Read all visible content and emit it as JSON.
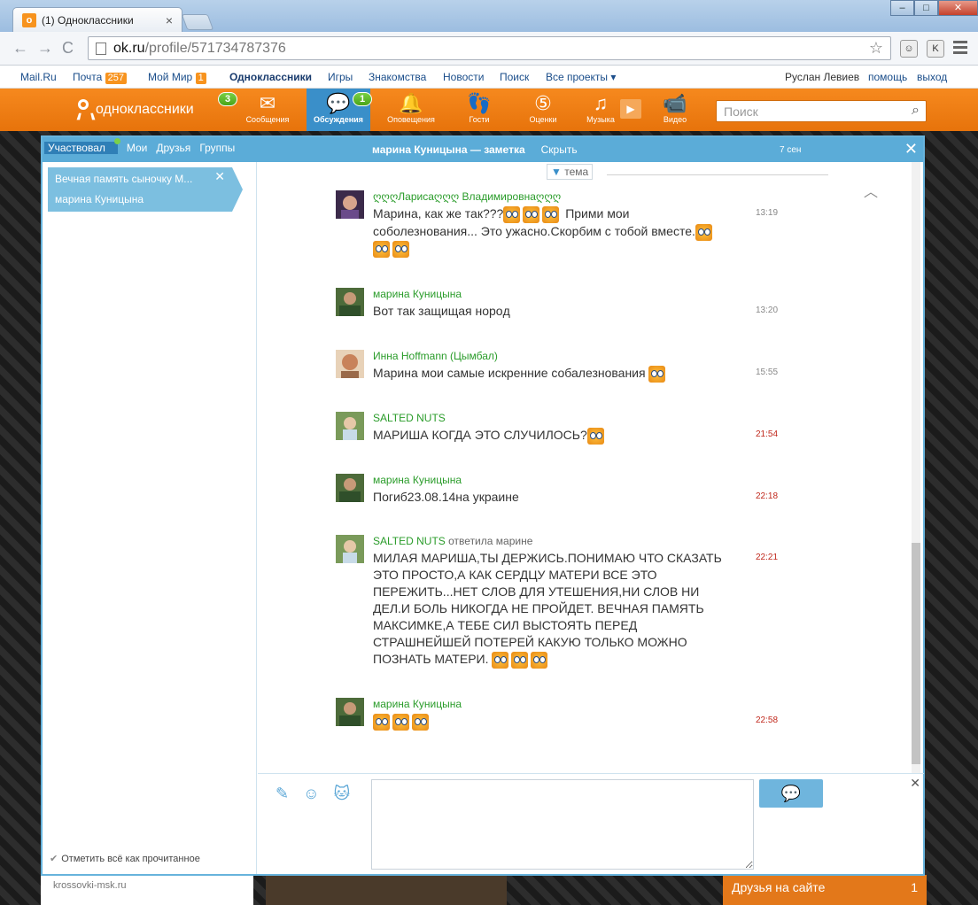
{
  "browser": {
    "tab_title": "(1) Одноклассники",
    "tab_close": "×",
    "url_host": "ok.ru",
    "url_path": "/profile/571734787376",
    "ext1": "☺",
    "ext2": "K"
  },
  "mailbar": {
    "mailru": "Mail.Ru",
    "pochta": "Почта",
    "pochta_count": "257",
    "moimir": "Мой Мир",
    "moimir_count": "1",
    "odnoklassniki": "Одноклассники",
    "igry": "Игры",
    "znakomstva": "Знакомства",
    "novosti": "Новости",
    "poisk": "Поиск",
    "vse_proekty": "Все проекты ▾",
    "user": "Руслан Левиев",
    "help": "помощь",
    "exit": "выход"
  },
  "okbar": {
    "logo": "одноклассники",
    "nav": [
      {
        "label": "Сообщения",
        "badge": "3"
      },
      {
        "label": "Обсуждения",
        "badge": "1"
      },
      {
        "label": "Оповещения",
        "badge": ""
      },
      {
        "label": "Гости",
        "badge": ""
      },
      {
        "label": "Оценки",
        "badge": ""
      },
      {
        "label": "Музыка",
        "badge": ""
      },
      {
        "label": "Видео",
        "badge": ""
      }
    ],
    "search_placeholder": "Поиск"
  },
  "panel": {
    "tabs": [
      "Участвовал",
      "Мои",
      "Друзья",
      "Группы"
    ],
    "title": "марина Куницына — заметка",
    "hide": "Скрыть",
    "date": "7 сен",
    "chat_item_title": "Вечная память сыночку М...",
    "chat_item_author": "марина Куницына",
    "mark_all": "Отметить всё как прочитанное",
    "tema": "тема"
  },
  "messages": [
    {
      "author": "ღღღЛарисаღღღ Владимировнаღღღ",
      "replied": "",
      "text": "Марина, как же так???",
      "text2": " Прими мои соболезнования... Это ужасно.Скорбим с тобой вместе.",
      "time": "13:19",
      "time_red": false
    },
    {
      "author": "марина Куницына",
      "replied": "",
      "text": "Вот так защищая норoд",
      "text2": "",
      "time": "13:20",
      "time_red": false
    },
    {
      "author": "Инна Hoffmann (Цымбал)",
      "replied": "",
      "text": "Марина мои самые искренние собалезнования",
      "text2": "",
      "time": "15:55",
      "time_red": false
    },
    {
      "author": "SALTED NUTS",
      "replied": "",
      "text": "МАРИША КОГДА ЭТО СЛУЧИЛОСЬ?",
      "text2": "",
      "time": "21:54",
      "time_red": true
    },
    {
      "author": "марина Куницына",
      "replied": "",
      "text": "Погиб23.08.14на украине",
      "text2": "",
      "time": "22:18",
      "time_red": true
    },
    {
      "author": "SALTED NUTS",
      "replied": "ответила марине",
      "text": "МИЛАЯ МАРИША,ТЫ ДЕРЖИСЬ.ПОНИМАЮ ЧТО СКАЗАТЬ ЭТО ПРОСТО,А КАК СЕРДЦУ МАТЕРИ ВСЕ ЭТО ПЕРЕЖИТЬ...НЕТ СЛОВ ДЛЯ УТЕШЕНИЯ,НИ СЛОВ НИ ДЕЛ.И БОЛЬ НИКОГДА НЕ ПРОЙДЕТ.  ВЕЧНАЯ ПАМЯТЬ МАКСИМКЕ,А ТЕБЕ СИЛ ВЫСТОЯТЬ ПЕРЕД СТРАШНЕЙШЕЙ ПОТЕРЕЙ КАКУЮ ТОЛЬКО МОЖНО ПОЗНАТЬ МАТЕРИ.",
      "text2": "",
      "time": "22:21",
      "time_red": true
    },
    {
      "author": "марина Куницына",
      "replied": "",
      "text": "",
      "text2": "",
      "time": "22:58",
      "time_red": true
    }
  ],
  "background": {
    "ad_text": "krossovki-msk.ru",
    "friends_online": "Друзья на сайте",
    "friends_count": "1"
  }
}
